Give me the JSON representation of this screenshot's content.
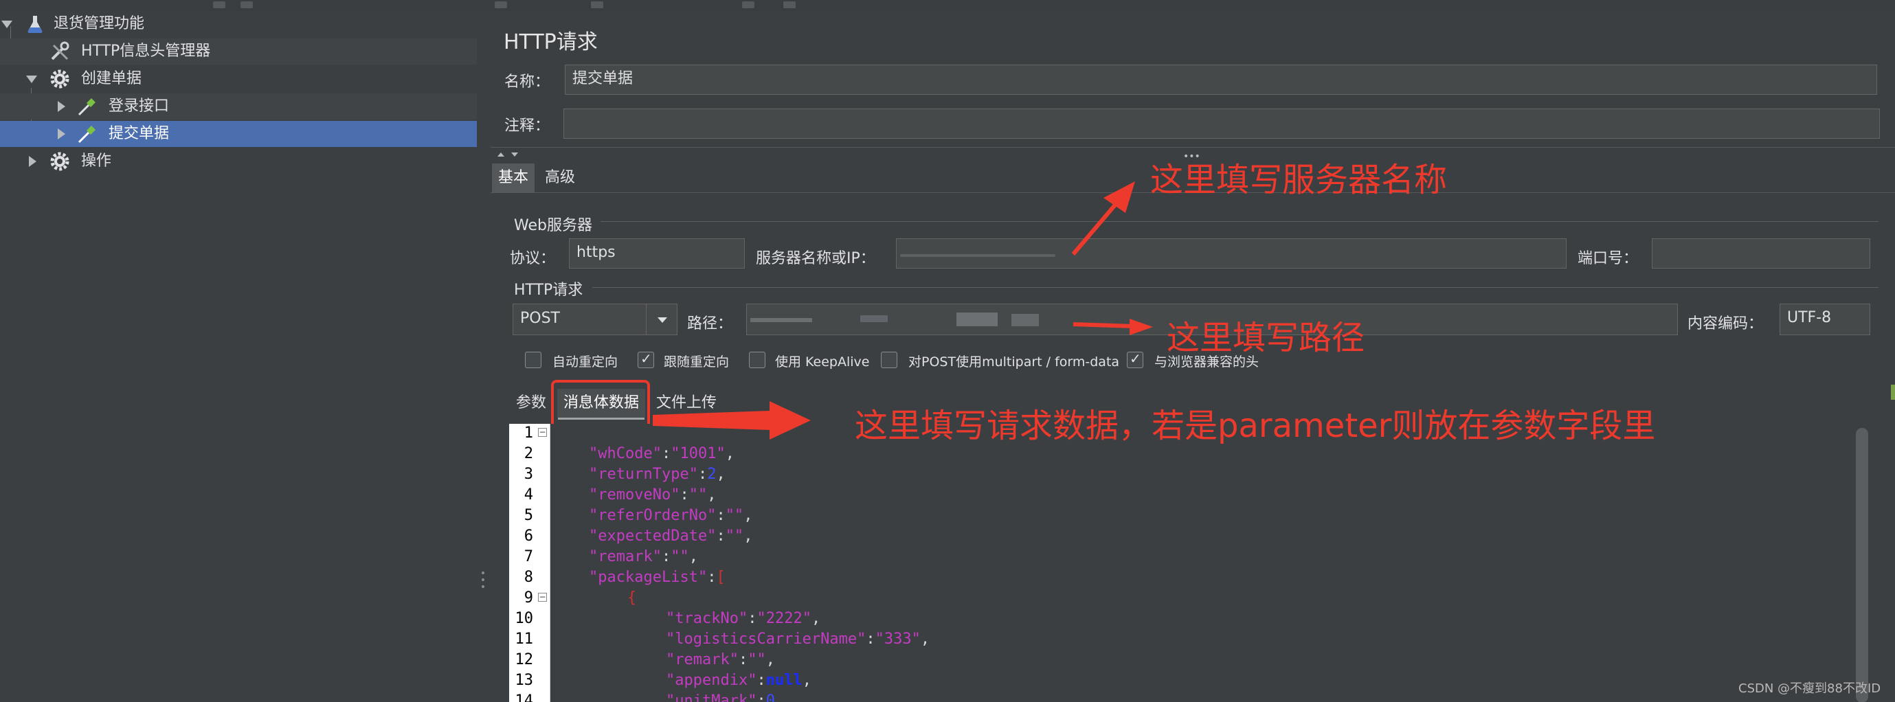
{
  "tree": {
    "items": [
      {
        "label": "退货管理功能"
      },
      {
        "label": "HTTP信息头管理器"
      },
      {
        "label": "创建单据"
      },
      {
        "label": "登录接口"
      },
      {
        "label": "提交单据"
      },
      {
        "label": "操作"
      }
    ]
  },
  "panel": {
    "title": "HTTP请求",
    "name_label": "名称：",
    "name_value": "提交单据",
    "comment_label": "注释：",
    "comment_value": "",
    "tabs": [
      {
        "label": "基本"
      },
      {
        "label": "高级"
      }
    ],
    "web_server": {
      "group_label": "Web服务器",
      "protocol_label": "协议：",
      "protocol_value": "https",
      "server_label": "服务器名称或IP：",
      "server_value": "",
      "port_label": "端口号：",
      "port_value": ""
    },
    "http_request": {
      "group_label": "HTTP请求",
      "method_value": "POST",
      "path_label": "路径：",
      "path_value": "",
      "encoding_label": "内容编码：",
      "encoding_value": "UTF-8"
    },
    "checkboxes": [
      {
        "label": "自动重定向",
        "checked": false
      },
      {
        "label": "跟随重定向",
        "checked": true
      },
      {
        "label": "使用 KeepAlive",
        "checked": false
      },
      {
        "label": "对POST使用multipart / form-data",
        "checked": false
      },
      {
        "label": "与浏览器兼容的头",
        "checked": true
      }
    ],
    "subtabs": [
      {
        "label": "参数"
      },
      {
        "label": "消息体数据"
      },
      {
        "label": "文件上传"
      }
    ]
  },
  "code_lines": [
    "1",
    "2",
    "3",
    "4",
    "5",
    "6",
    "7",
    "8",
    "9",
    "10",
    "11",
    "12",
    "13",
    "14"
  ],
  "code": {
    "l2_key": "\"whCode\"",
    "l2_val": "\"1001\"",
    "l3_key": "\"returnType\"",
    "l3_val": "2",
    "l4_key": "\"removeNo\"",
    "l4_val": "\"\"",
    "l5_key": "\"referOrderNo\"",
    "l5_val": "\"\"",
    "l6_key": "\"expectedDate\"",
    "l6_val": "\"\"",
    "l7_key": "\"remark\"",
    "l7_val": "\"\"",
    "l8_key": "\"packageList\"",
    "l8_val": "[",
    "l9_val": "{",
    "l10_key": "\"trackNo\"",
    "l10_val": "\"2222\"",
    "l11_key": "\"logisticsCarrierName\"",
    "l11_val": "\"333\"",
    "l12_key": "\"remark\"",
    "l12_val": "\"\"",
    "l13_key": "\"appendix\"",
    "l13_val": "null",
    "l14_key": "\"unitMark\"",
    "l14_val": "0"
  },
  "annotations": {
    "server": "这里填写服务器名称",
    "path": "这里填写路径",
    "body": "这里填写请求数据，若是parameter则放在参数字段里"
  },
  "watermark": "CSDN @不瘦到88不改ID",
  "colors": {
    "accent_red": "#ee3a2d",
    "selection": "#4b6eaf",
    "background": "#3c3f41"
  }
}
